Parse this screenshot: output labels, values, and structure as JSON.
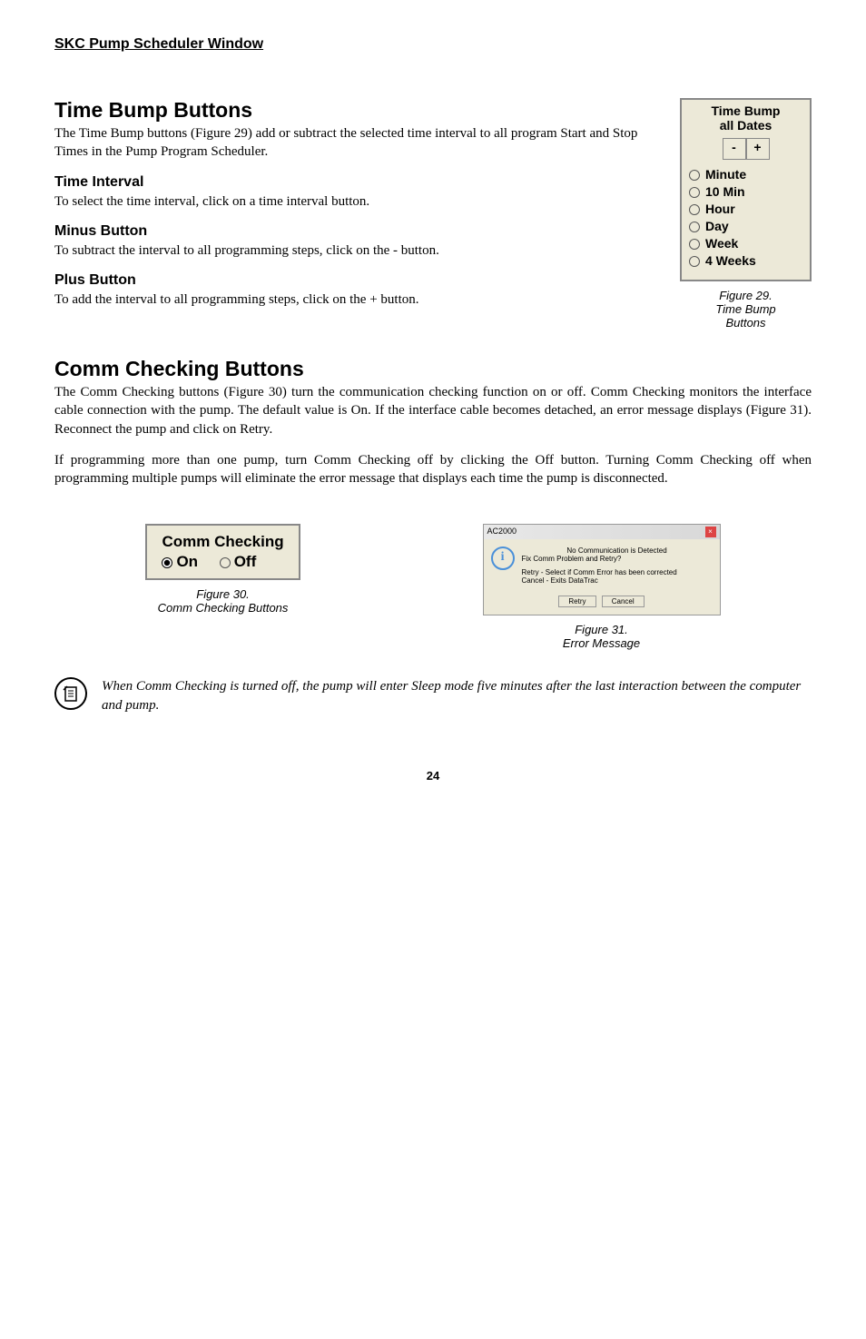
{
  "header": {
    "title": "SKC Pump Scheduler Window"
  },
  "section1": {
    "heading": "Time Bump Buttons",
    "intro": "The Time Bump buttons (Figure 29) add or subtract the selected time interval to all program Start and Stop Times in the Pump Program Scheduler.",
    "sub1": {
      "heading": "Time Interval",
      "text": "To select the time interval, click on a time interval button."
    },
    "sub2": {
      "heading": "Minus Button",
      "text": "To subtract the interval to all programming steps, click on the - button."
    },
    "sub3": {
      "heading": "Plus Button",
      "text": "To add the interval to all programming steps, click on the + button."
    }
  },
  "timebump_panel": {
    "title_line1": "Time Bump",
    "title_line2": "all Dates",
    "minus": "-",
    "plus": "+",
    "options": [
      "Minute",
      "10 Min",
      "Hour",
      "Day",
      "Week",
      "4 Weeks"
    ]
  },
  "figure29": {
    "line1": "Figure 29.",
    "line2": "Time Bump",
    "line3": "Buttons"
  },
  "section2": {
    "heading": "Comm Checking Buttons",
    "para1": "The Comm Checking buttons (Figure 30) turn the communication checking function on or off. Comm Checking monitors the interface cable connection with the pump. The default value is On. If the interface cable becomes detached, an error message displays (Figure 31). Reconnect the pump and click on Retry.",
    "para2": "If programming more than one pump, turn Comm Checking off by clicking the Off button. Turning Comm Checking off when programming multiple pumps will eliminate the error message that displays each time the pump is disconnected."
  },
  "comm_checking": {
    "title": "Comm Checking",
    "on": "On",
    "off": "Off"
  },
  "figure30": {
    "line1": "Figure 30.",
    "line2": "Comm Checking Buttons"
  },
  "error_dialog": {
    "titlebar": "AC2000",
    "line1": "No Communication is Detected",
    "line2": "Fix Comm Problem and Retry?",
    "line3": "Retry   - Select if Comm Error has been corrected",
    "line4": "Cancel - Exits DataTrac",
    "btn_retry": "Retry",
    "btn_cancel": "Cancel"
  },
  "figure31": {
    "line1": "Figure 31.",
    "line2": "Error Message"
  },
  "note": {
    "text": "When Comm Checking is turned off, the pump will enter Sleep mode five minutes after the last interaction between the computer and pump."
  },
  "page_number": "24"
}
